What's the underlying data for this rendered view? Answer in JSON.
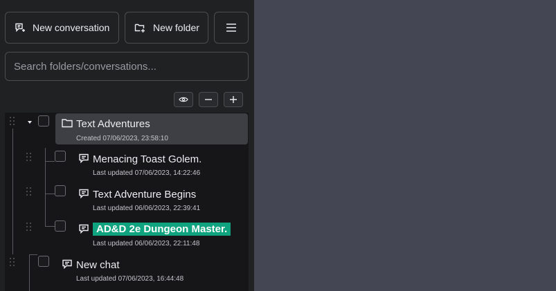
{
  "toolbar": {
    "new_conversation_label": "New conversation",
    "new_folder_label": "New folder",
    "menu_icon": "hamburger-icon"
  },
  "search": {
    "placeholder": "Search folders/conversations...",
    "value": ""
  },
  "tree_tools": [
    "eye-icon",
    "collapse-icon",
    "expand-icon"
  ],
  "folder": {
    "title": "Text Adventures",
    "created": "Created 07/06/2023, 23:58:10",
    "expanded": true,
    "conversations": [
      {
        "title": "Menacing Toast Golem.",
        "updated": "Last updated 07/06/2023, 14:22:46",
        "highlighted": false
      },
      {
        "title": "Text Adventure Begins",
        "updated": "Last updated 06/06/2023, 22:39:41",
        "highlighted": false
      },
      {
        "title": "AD&D 2e Dungeon Master.",
        "updated": "Last updated 06/06/2023, 22:11:48",
        "highlighted": true
      }
    ]
  },
  "root_conversation": {
    "title": "New chat",
    "updated": "Last updated 07/06/2023, 16:44:48"
  },
  "colors": {
    "sidebar": "#202123",
    "main": "#444654",
    "highlight": "#10a37f",
    "selected_row": "#3e3f44"
  }
}
